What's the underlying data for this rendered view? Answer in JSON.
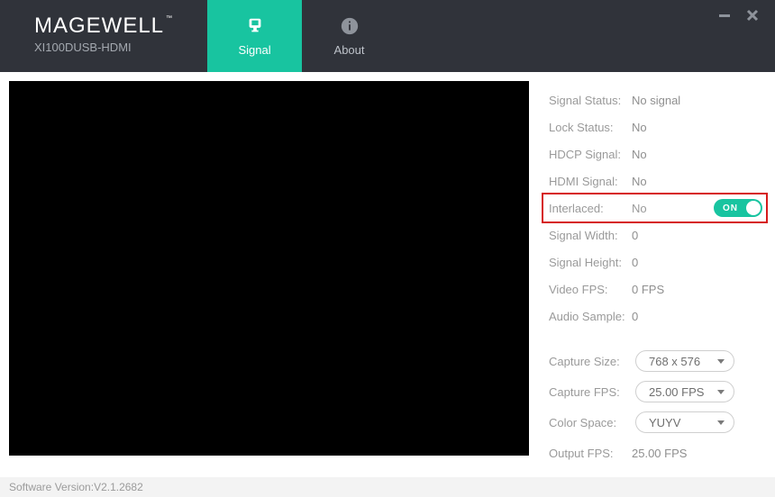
{
  "brand": {
    "name": "MAGEWELL",
    "tm": "™",
    "subtitle": "XI100DUSB-HDMI"
  },
  "nav": {
    "signal": "Signal",
    "about": "About"
  },
  "status": {
    "signal_status_label": "Signal Status:",
    "signal_status_value": "No signal",
    "lock_status_label": "Lock Status:",
    "lock_status_value": "No",
    "hdcp_label": "HDCP Signal:",
    "hdcp_value": "No",
    "hdmi_label": "HDMI Signal:",
    "hdmi_value": "No",
    "interlaced_label": "Interlaced:",
    "interlaced_value": "No",
    "interlaced_toggle": "ON",
    "signal_width_label": "Signal Width:",
    "signal_width_value": "0",
    "signal_height_label": "Signal Height:",
    "signal_height_value": "0",
    "video_fps_label": "Video FPS:",
    "video_fps_value": "0 FPS",
    "audio_sample_label": "Audio Sample:",
    "audio_sample_value": "0"
  },
  "capture": {
    "size_label": "Capture Size:",
    "size_value": "768 x 576",
    "fps_label": "Capture FPS:",
    "fps_value": "25.00 FPS",
    "color_label": "Color Space:",
    "color_value": "YUYV",
    "output_fps_label": "Output FPS:",
    "output_fps_value": "25.00 FPS"
  },
  "footer": {
    "version_label": "Software Version: ",
    "version_value": "V2.1.2682"
  }
}
